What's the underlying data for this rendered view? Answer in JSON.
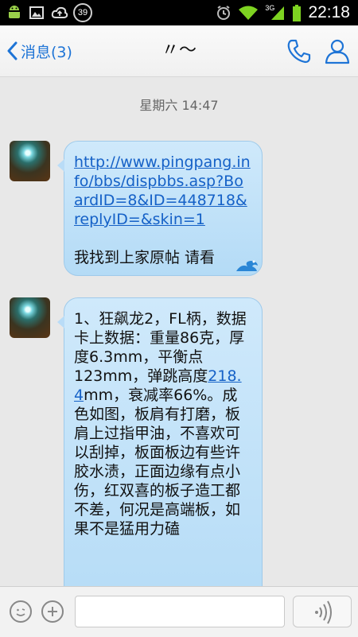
{
  "status_bar": {
    "time": "22:18",
    "battery_badge": "39",
    "network": "3G"
  },
  "header": {
    "back_label": "消息(3)",
    "title": "〃～"
  },
  "chat": {
    "timestamp": "星期六 14:47",
    "messages": [
      {
        "link": "http://www.pingpang.info/bbs/dispbbs.asp?BoardID=8&ID=448718&replyID=&skin=1",
        "text": "我找到上家原帖 请看"
      },
      {
        "text_part1": "1、狂飙龙2，FL柄，数据卡上数据：重量86克，厚度6.3mm，平衡点123mm，弹跳高度",
        "link": "218.4",
        "text_part2": "mm，衰减率66%。成色如图，板肩有打磨，板肩上过指甲油，不喜欢可以刮掉，板面板边有些许胶水渍，正面边缘有点小伤，红双喜的板子造工都不差，何况是高端板，如果不是猛用力磕"
      }
    ]
  },
  "input_bar": {
    "placeholder": ""
  },
  "colors": {
    "accent": "#1e74d6",
    "bubble": "#c4e3f8",
    "link": "#1561c7"
  }
}
